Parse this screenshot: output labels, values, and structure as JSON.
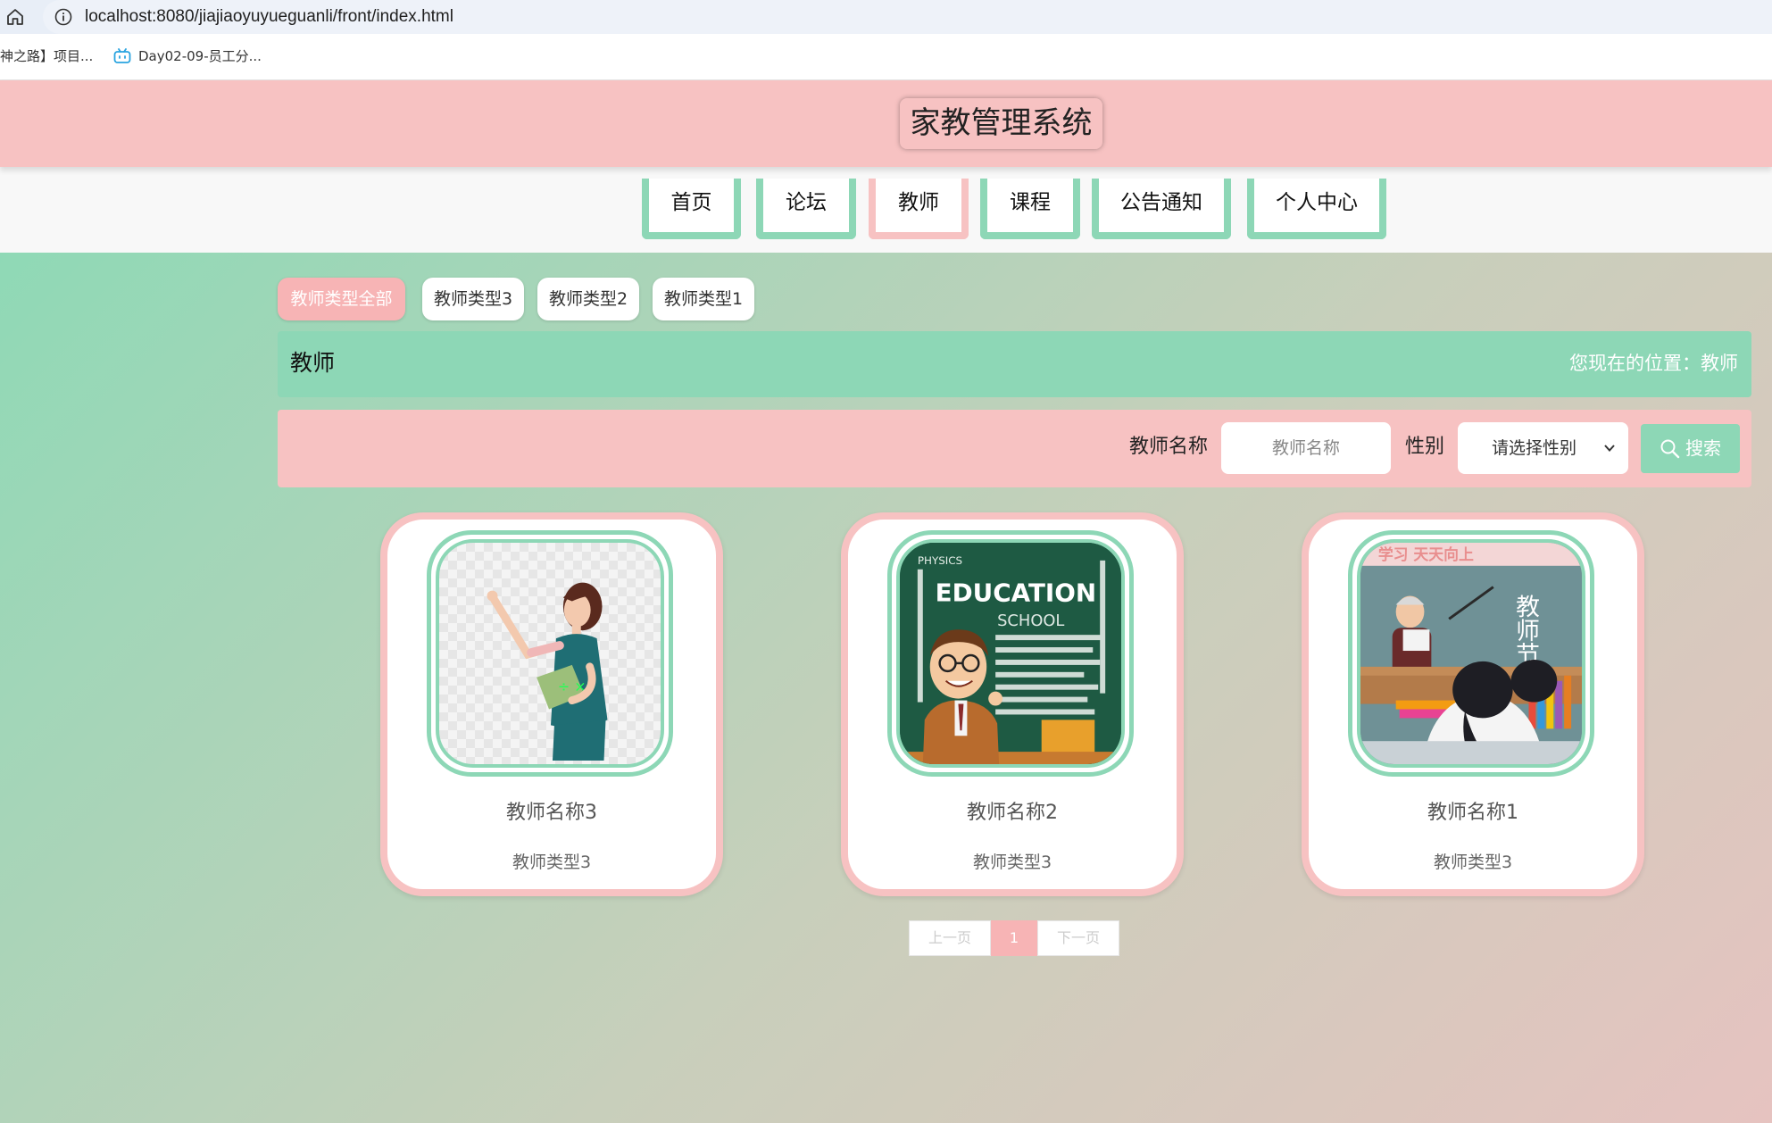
{
  "browser": {
    "url": "localhost:8080/jiajiaoyuyueguanli/front/index.html",
    "bookmarks": [
      "神之路】项目...",
      "Day02-09-员工分..."
    ]
  },
  "header": {
    "title": "家教管理系统"
  },
  "nav": {
    "items": [
      {
        "label": "首页"
      },
      {
        "label": "论坛"
      },
      {
        "label": "教师"
      },
      {
        "label": "课程"
      },
      {
        "label": "公告通知"
      },
      {
        "label": "个人中心"
      }
    ],
    "active": "教师"
  },
  "type_tabs": [
    "教师类型全部",
    "教师类型3",
    "教师类型2",
    "教师类型1"
  ],
  "breadcrumb": {
    "title": "教师",
    "position": "您现在的位置：教师"
  },
  "search": {
    "name_label": "教师名称",
    "name_placeholder": "教师名称",
    "gender_label": "性别",
    "gender_selected": "请选择性别",
    "button_label": "搜索"
  },
  "cards": [
    {
      "name": "教师名称3",
      "type": "教师类型3"
    },
    {
      "name": "教师名称2",
      "type": "教师类型3"
    },
    {
      "name": "教师名称1",
      "type": "教师类型3"
    }
  ],
  "card_image_text": {
    "education": "EDUCATION",
    "school": "SCHOOL",
    "physics": "PHYSICS",
    "teacher_day": "教师节",
    "banner": "学习 天天向上"
  },
  "pagination": {
    "prev": "上一页",
    "current": "1",
    "next": "下一页"
  },
  "colors": {
    "pink": "#f7c2c2",
    "green": "#8dd7b6",
    "active_pink": "#f7b4b5"
  }
}
